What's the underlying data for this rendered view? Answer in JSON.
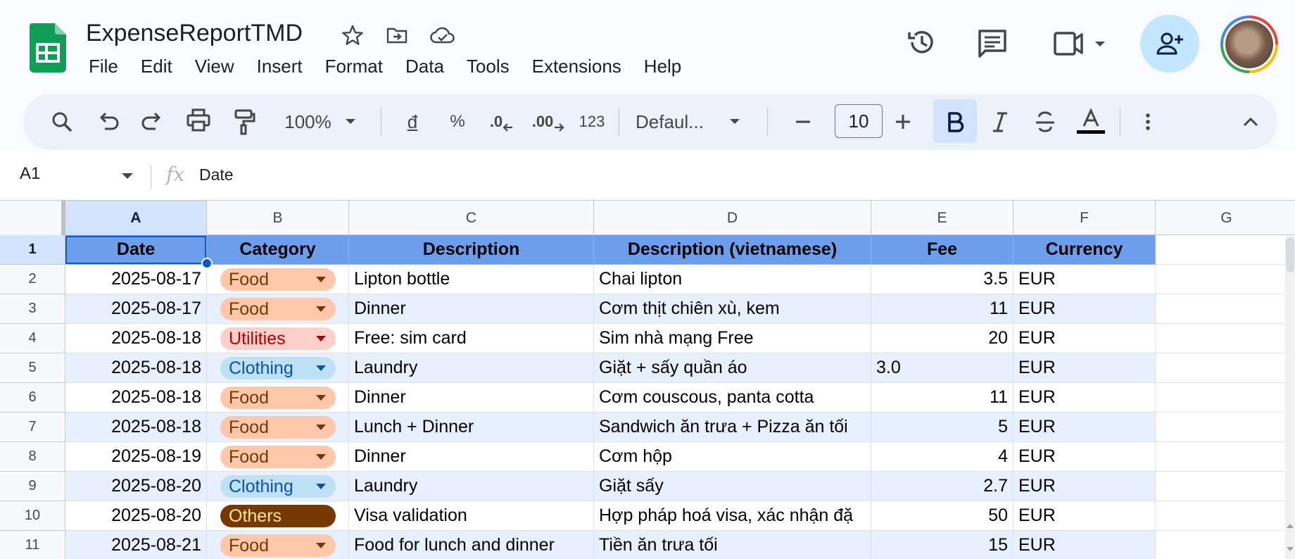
{
  "document": {
    "title": "ExpenseReportTMD"
  },
  "menu": [
    "File",
    "Edit",
    "View",
    "Insert",
    "Format",
    "Data",
    "Tools",
    "Extensions",
    "Help"
  ],
  "toolbar": {
    "zoom": "100%",
    "currency_label": "đ",
    "percent_label": "%",
    "decrease_decimal_label": ".0",
    "increase_decimal_label": ".00",
    "number_format_label": "123",
    "font_family": "Defaul...",
    "font_size": "10"
  },
  "formula_bar": {
    "name_box": "A1",
    "value": "Date"
  },
  "columns": [
    "A",
    "B",
    "C",
    "D",
    "E",
    "F",
    "G"
  ],
  "header_row": {
    "row_number": "1",
    "cells": [
      "Date",
      "Category",
      "Description",
      "Description (vietnamese)",
      "Fee",
      "Currency"
    ]
  },
  "rows": [
    {
      "row_number": "2",
      "date": "2025-08-17",
      "category": "Food",
      "description": "Lipton bottle",
      "description_vi": "Chai lipton",
      "fee": "3.5",
      "currency": "EUR"
    },
    {
      "row_number": "3",
      "date": "2025-08-17",
      "category": "Food",
      "description": "Dinner",
      "description_vi": "Cơm thịt chiên xù, kem",
      "fee": "11",
      "currency": "EUR"
    },
    {
      "row_number": "4",
      "date": "2025-08-18",
      "category": "Utilities",
      "description": "Free: sim card",
      "description_vi": "Sim nhà mạng Free",
      "fee": "20",
      "currency": "EUR"
    },
    {
      "row_number": "5",
      "date": "2025-08-18",
      "category": "Clothing",
      "description": "Laundry",
      "description_vi": "Giặt + sấy quần áo",
      "fee": "3.0",
      "currency": "EUR"
    },
    {
      "row_number": "6",
      "date": "2025-08-18",
      "category": "Food",
      "description": "Dinner",
      "description_vi": "Cơm couscous, panta cotta",
      "fee": "11",
      "currency": "EUR"
    },
    {
      "row_number": "7",
      "date": "2025-08-18",
      "category": "Food",
      "description": "Lunch + Dinner",
      "description_vi": "Sandwich ăn trưa + Pizza ăn tối",
      "fee": "5",
      "currency": "EUR"
    },
    {
      "row_number": "8",
      "date": "2025-08-19",
      "category": "Food",
      "description": "Dinner",
      "description_vi": "Cơm hộp",
      "fee": "4",
      "currency": "EUR"
    },
    {
      "row_number": "9",
      "date": "2025-08-20",
      "category": "Clothing",
      "description": "Laundry",
      "description_vi": "Giặt sấy",
      "fee": "2.7",
      "currency": "EUR"
    },
    {
      "row_number": "10",
      "date": "2025-08-20",
      "category": "Others",
      "description": "Visa validation",
      "description_vi": "Hợp pháp hoá visa, xác nhận đặ",
      "fee": "50",
      "currency": "EUR"
    },
    {
      "row_number": "11",
      "date": "2025-08-21",
      "category": "Food",
      "description": "Food for lunch and dinner",
      "description_vi": "Tiền ăn trưa tối",
      "fee": "15",
      "currency": "EUR"
    }
  ],
  "category_colors": {
    "Food": {
      "bg": "#ffc8aa",
      "fg": "#753800"
    },
    "Utilities": {
      "bg": "#ffcfc9",
      "fg": "#b10202"
    },
    "Clothing": {
      "bg": "#bfe1f6",
      "fg": "#0a53a8"
    },
    "Others": {
      "bg": "#753800",
      "fg": "#ffe5a0"
    }
  },
  "colors": {
    "header_fill": "#6d9eeb",
    "band_fill": "#e8f0fe",
    "selection": "#0b57d0",
    "share_button": "#c2e7ff",
    "sheets_green": "#0f9d58"
  }
}
